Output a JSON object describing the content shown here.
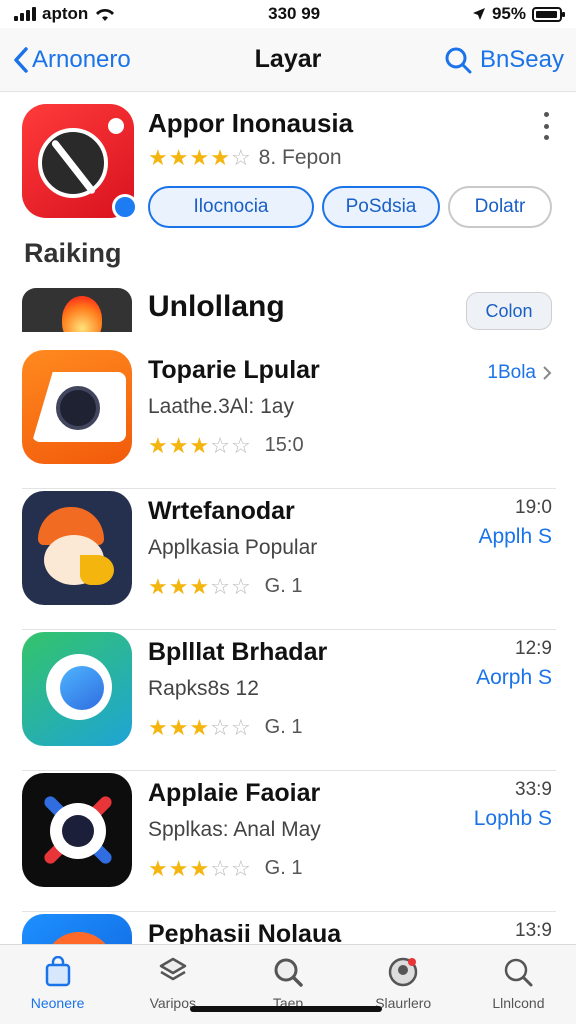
{
  "status_bar": {
    "carrier": "apton",
    "time": "330 99",
    "battery": "95%",
    "battery_level": 0.95
  },
  "nav": {
    "back_label": "Arnonero",
    "title": "Layar",
    "right_label": "BnSeay"
  },
  "featured": {
    "title": "Appor Inonausia",
    "rating": 4,
    "meta": "8. Fepon",
    "pills": [
      "Ilocnocia",
      "PoSdsia",
      "Dolatr"
    ]
  },
  "section": {
    "label": "Raiking"
  },
  "ranking": {
    "title": "Unlollang",
    "button": "Colon"
  },
  "apps": [
    {
      "name": "Toparie Lpular",
      "sub": "Laathe.3Al: 1ay",
      "rating": 3,
      "count": "15:0",
      "link": "1Bola",
      "icon": "camera-icon"
    },
    {
      "name": "Wrtefanodar",
      "sub": "Applkasia Popular",
      "rating": 3,
      "count": "G. 1",
      "time": "19:0",
      "link": "Applh S",
      "icon": "bird-icon"
    },
    {
      "name": "Bplllat Brhadar",
      "sub": "Rapks8s 12",
      "rating": 3,
      "count": "G. 1",
      "time": "12:9",
      "link": "Aorph S",
      "icon": "chat-icon"
    },
    {
      "name": "Applaie Faoiar",
      "sub": "Spplkas: Anal May",
      "rating": 3,
      "count": "G. 1",
      "time": "33:9",
      "link": "Lophb S",
      "icon": "lens-icon"
    },
    {
      "name": "Pephasii Nolaua",
      "sub": "",
      "rating": 0,
      "count": "",
      "time": "13:9",
      "link": "",
      "icon": "blob-icon"
    }
  ],
  "tabs": [
    {
      "label": "Neonere",
      "icon": "bag-icon",
      "active": true
    },
    {
      "label": "Varipos",
      "icon": "layers-icon",
      "active": false
    },
    {
      "label": "Taep",
      "icon": "search-icon",
      "active": false
    },
    {
      "label": "Slaurlero",
      "icon": "profile-icon",
      "active": false
    },
    {
      "label": "Llnlcond",
      "icon": "search-icon",
      "active": false
    }
  ]
}
